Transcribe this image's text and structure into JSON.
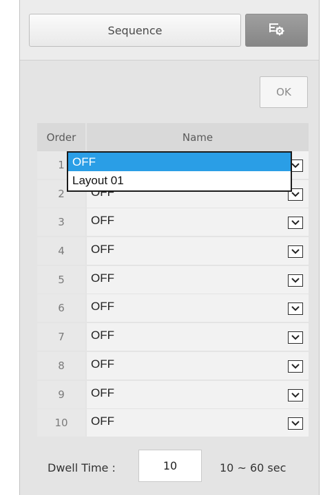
{
  "tabs": {
    "sequence_label": "Sequence",
    "settings_icon": "settings-gear-icon"
  },
  "ok_button": {
    "label": "OK"
  },
  "table": {
    "headers": {
      "order": "Order",
      "name": "Name"
    },
    "rows": [
      {
        "order": "1",
        "value": "OFF"
      },
      {
        "order": "2",
        "value": "OFF"
      },
      {
        "order": "3",
        "value": "OFF"
      },
      {
        "order": "4",
        "value": "OFF"
      },
      {
        "order": "5",
        "value": "OFF"
      },
      {
        "order": "6",
        "value": "OFF"
      },
      {
        "order": "7",
        "value": "OFF"
      },
      {
        "order": "8",
        "value": "OFF"
      },
      {
        "order": "9",
        "value": "OFF"
      },
      {
        "order": "10",
        "value": "OFF"
      }
    ]
  },
  "dropdown_popup": {
    "options": [
      {
        "label": "OFF",
        "selected": true
      },
      {
        "label": "Layout 01",
        "selected": false
      }
    ],
    "highlight_color": "#2a9ee6"
  },
  "dwell": {
    "label": "Dwell Time :",
    "value": "10",
    "range": "10 ~ 60 sec"
  }
}
